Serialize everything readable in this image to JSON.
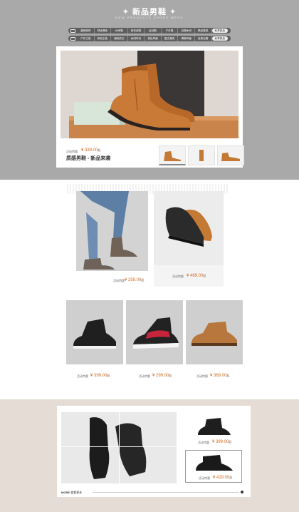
{
  "header": {
    "title": "新品男鞋",
    "subtitle": "NEW PRODUCTS SHOES WEEK",
    "nav_row1": [
      "重磅推荐",
      "舒适清爽",
      "休闲鞋",
      "商务皮鞋",
      "运动鞋",
      "户外鞋",
      "百搭休闲",
      "精品鞋类",
      "私享新品"
    ],
    "nav_row2": [
      "户外之旅",
      "商务正装",
      "潮流前卫",
      "休闲时尚",
      "英伦风格",
      "复古潮流",
      "清新风格",
      "经典百搭",
      "私享新品"
    ]
  },
  "colors": {
    "price_accent": "#d4691c",
    "header_bg": "#a9a9a9",
    "footer_bg": "#e5ddd5"
  },
  "hero": {
    "price_label": "活动特惠",
    "price": "¥ 339.00",
    "price_suffix": "起",
    "name": "质感男鞋 - 新品来袭"
  },
  "section2": [
    {
      "price_label": "活动特惠",
      "price": "¥ 259.00",
      "price_suffix": "起"
    },
    {
      "price_label": "活动特惠",
      "price": "¥ 469.00",
      "price_suffix": "起"
    }
  ],
  "section3": [
    {
      "price_label": "活动特惠",
      "price": "¥ 399.00",
      "price_suffix": "起"
    },
    {
      "price_label": "活动特惠",
      "price": "¥ 299.00",
      "price_suffix": "起"
    },
    {
      "price_label": "活动特惠",
      "price": "¥ 369.00",
      "price_suffix": "起"
    }
  ],
  "section4": {
    "products": [
      {
        "price_label": "活动特惠",
        "price": "¥ 399.00",
        "price_suffix": "起"
      },
      {
        "price_label": "活动特惠",
        "price": "¥ 419.00",
        "price_suffix": "起"
      }
    ],
    "more": "MORE",
    "more_sub": "查看更多"
  }
}
